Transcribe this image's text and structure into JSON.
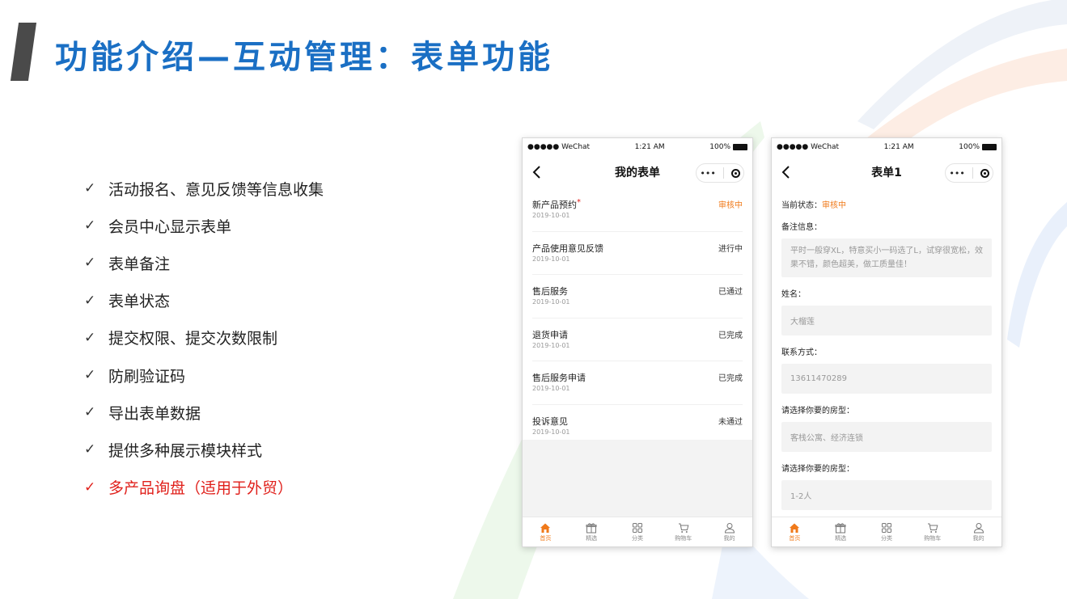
{
  "page": {
    "title": "功能介绍—互动管理：表单功能"
  },
  "features": [
    {
      "check": "✓",
      "text": "活动报名、意见反馈等信息收集"
    },
    {
      "check": "✓",
      "text": "会员中心显示表单"
    },
    {
      "check": "✓",
      "text": "表单备注"
    },
    {
      "check": "✓",
      "text": "表单状态"
    },
    {
      "check": "✓",
      "text": "提交权限、提交次数限制"
    },
    {
      "check": "✓",
      "text": "防刷验证码"
    },
    {
      "check": "✓",
      "text": "导出表单数据"
    },
    {
      "check": "✓",
      "text": "提供多种展示模块样式"
    },
    {
      "check": "✓",
      "text": "多产品询盘（适用于外贸）"
    }
  ],
  "colors": {
    "title_blue": "#1a6fc4",
    "highlight_red": "#e0201b",
    "accent_orange": "#f07a1a"
  },
  "phone_status": {
    "carrier": "●●●●● WeChat",
    "time": "1:21 AM",
    "battery": "100%"
  },
  "phone1": {
    "nav_title": "我的表单",
    "forms": [
      {
        "name": "新产品预约",
        "required": "*",
        "date": "2019-10-01",
        "status": "审核中"
      },
      {
        "name": "产品使用意见反馈",
        "required": "",
        "date": "2019-10-01",
        "status": "进行中"
      },
      {
        "name": "售后服务",
        "required": "",
        "date": "2019-10-01",
        "status": "已通过"
      },
      {
        "name": "退货申请",
        "required": "",
        "date": "2019-10-01",
        "status": "已完成"
      },
      {
        "name": "售后服务申请",
        "required": "",
        "date": "2019-10-01",
        "status": "已完成"
      },
      {
        "name": "投诉意见",
        "required": "",
        "date": "2019-10-01",
        "status": "未通过"
      }
    ]
  },
  "phone2": {
    "nav_title": "表单1",
    "status_label": "当前状态：",
    "status_value": "审核中",
    "remark_label": "备注信息：",
    "remark_value": "平时一般穿XL，特意买小一码选了L，试穿很宽松，效果不错，颜色超美，做工质量佳！",
    "name_label": "姓名：",
    "name_value": "大榴莲",
    "contact_label": "联系方式：",
    "contact_value": "13611470289",
    "room_label_1": "请选择你要的房型：",
    "room_value_1": "客栈公寓、经济连锁",
    "room_label_2": "请选择你要的房型：",
    "room_value_2": "1-2人"
  },
  "tabs": [
    {
      "label": "首页",
      "icon": "home-icon"
    },
    {
      "label": "精选",
      "icon": "gift-icon"
    },
    {
      "label": "分类",
      "icon": "grid-icon"
    },
    {
      "label": "购物车",
      "icon": "cart-icon"
    },
    {
      "label": "我的",
      "icon": "user-icon"
    }
  ]
}
